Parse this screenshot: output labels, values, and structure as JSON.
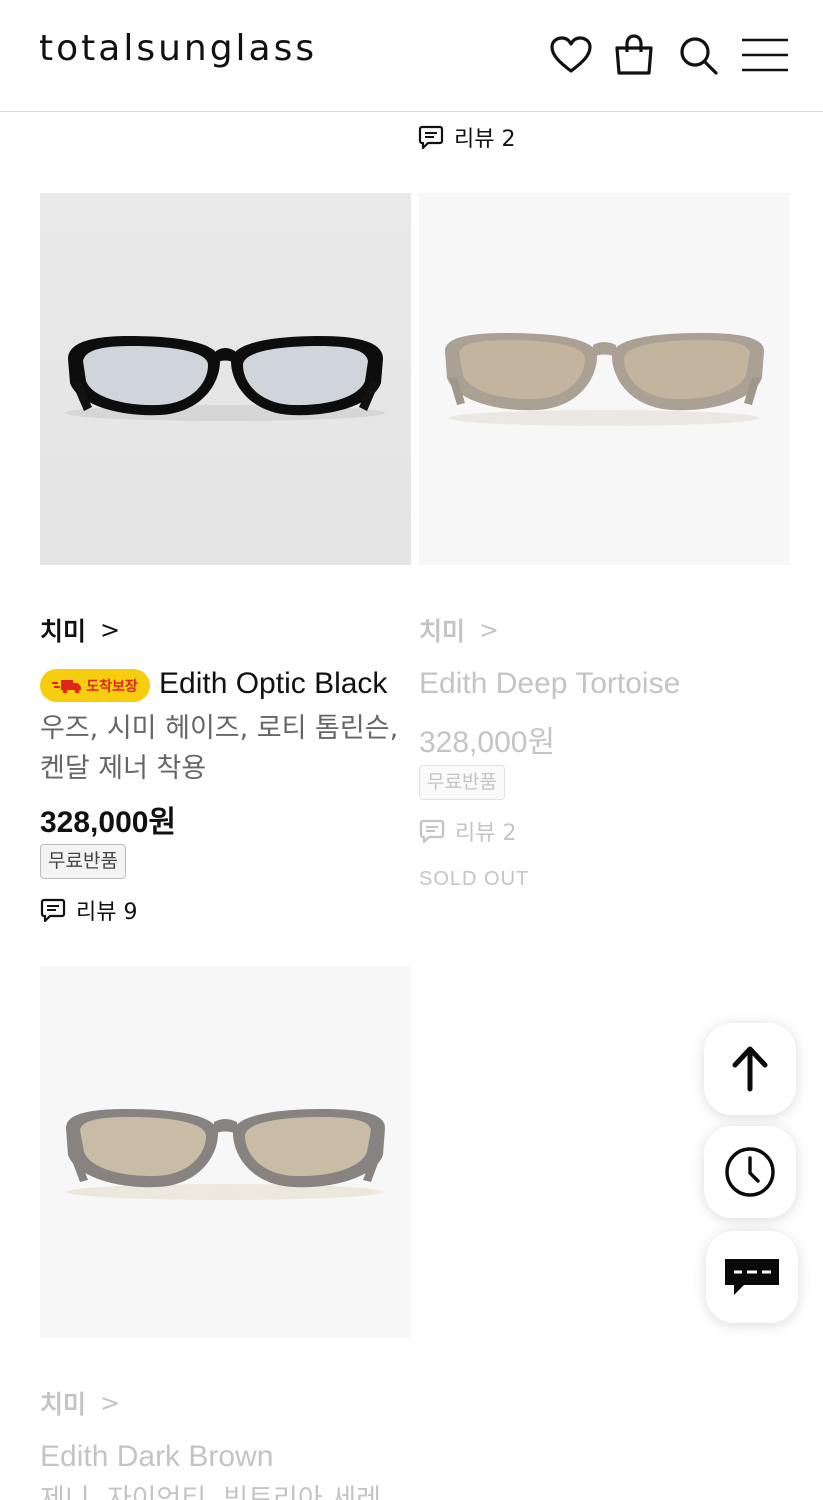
{
  "header": {
    "logo": "totalsunglass",
    "icons": [
      "heart-icon",
      "shopping-bag-icon",
      "search-icon",
      "menu-icon"
    ]
  },
  "prev_item": {
    "review_label": "리뷰 2"
  },
  "products": [
    {
      "brand": "치미",
      "chevron": ">",
      "badge": "도착보장",
      "name": "Edith Optic Black",
      "desc": "우즈, 시미 헤이즈, 로티 톰린슨, 켄달 제너 착용",
      "price": "328,000원",
      "tag": "무료반품",
      "review_label": "리뷰 9",
      "sold_out": false,
      "lens_color": "#c9d0d6"
    },
    {
      "brand": "치미",
      "chevron": ">",
      "name": "Edith Deep Tortoise",
      "price": "328,000원",
      "tag": "무료반품",
      "review_label": "리뷰 2",
      "sold_out_label": "SOLD OUT",
      "sold_out": true,
      "lens_color": "#b9a98a"
    },
    {
      "brand": "치미",
      "chevron": ">",
      "name": "Edith Dark Brown",
      "desc": "제니, 자이언티, 빅토리아 세레",
      "sold_out": true,
      "lens_color": "#c9bb9c"
    }
  ],
  "floating_buttons": [
    "scroll-top-icon",
    "recent-clock-icon",
    "chat-icon"
  ],
  "colors": {
    "badge_bg": "#f7cd0f",
    "badge_text": "#e0251b",
    "muted": "#c4c4c4"
  }
}
